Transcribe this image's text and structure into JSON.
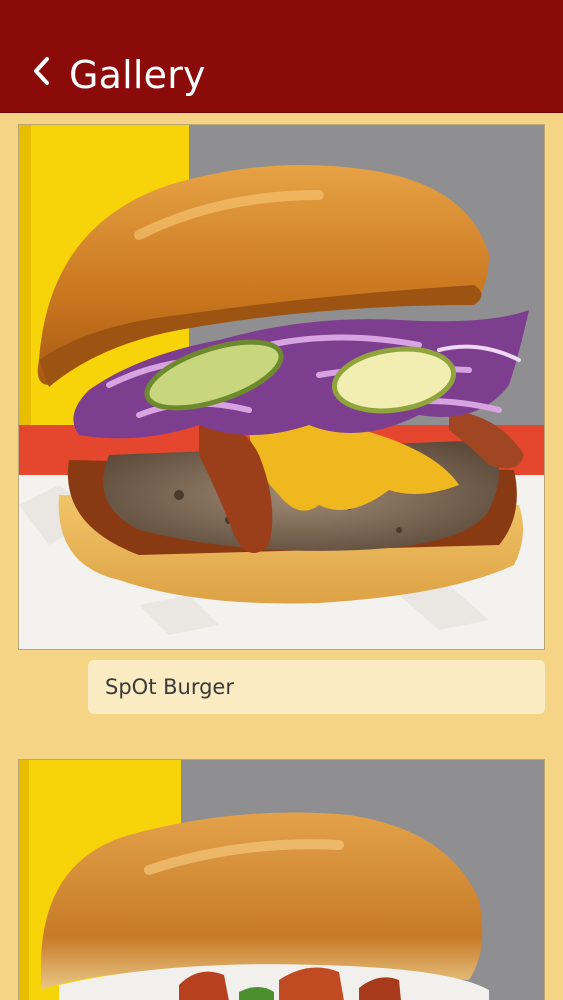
{
  "header": {
    "title": "Gallery",
    "back_icon": "chevron-left-icon",
    "background_color": "#8B0A0A",
    "title_color": "#FFFFFF"
  },
  "gallery": {
    "background_color": "#F5D585",
    "items": [
      {
        "caption": "SpOt Burger",
        "image": "burger-with-purple-slaw-bacon-cheese-pickles-photo"
      },
      {
        "caption": "",
        "image": "burger-with-bacon-and-sauce-photo"
      }
    ]
  }
}
